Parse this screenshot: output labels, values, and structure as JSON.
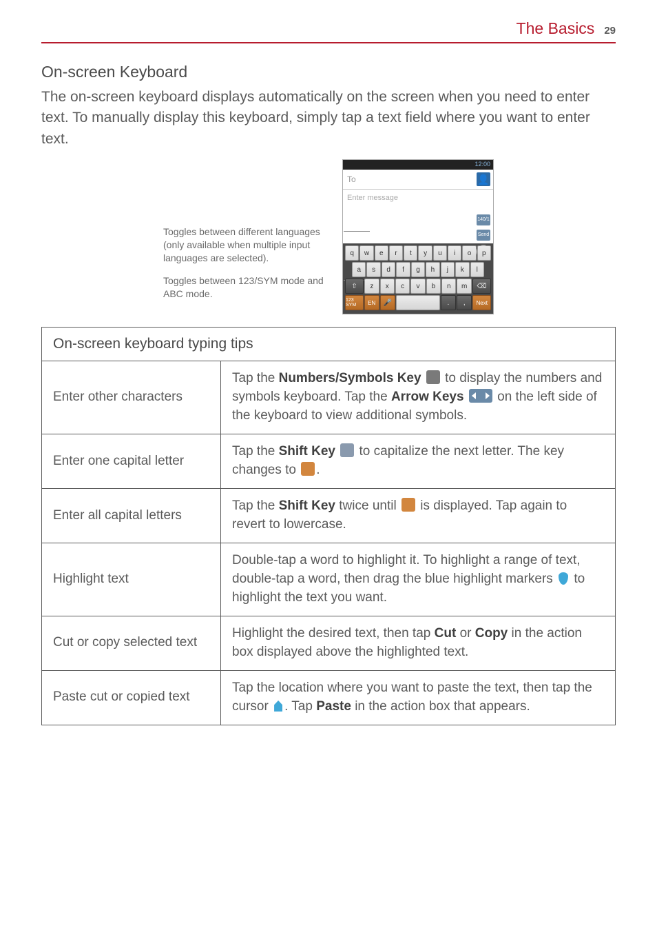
{
  "header": {
    "title": "The Basics",
    "page": "29"
  },
  "section": {
    "title": "On-screen Keyboard",
    "intro": "The on-screen keyboard displays automatically on the screen when you need to enter text. To manually display this keyboard, simply tap a text field where you want to enter text."
  },
  "callouts": {
    "lang": "Toggles between different languages (only available when multiple input languages are selected).",
    "mode": "Toggles between 123/SYM mode and ABC mode."
  },
  "phone": {
    "time": "12:00",
    "to_placeholder": "To",
    "msg_placeholder": "Enter message",
    "char_badge": "140/1",
    "send": "Send",
    "row1": [
      "q",
      "w",
      "e",
      "r",
      "t",
      "y",
      "u",
      "i",
      "o",
      "p"
    ],
    "row2": [
      "a",
      "s",
      "d",
      "f",
      "g",
      "h",
      "j",
      "k",
      "l"
    ],
    "row3_shift": "⇧",
    "row3": [
      "z",
      "x",
      "c",
      "v",
      "b",
      "n",
      "m"
    ],
    "row3_del": "⌫",
    "row4_sym": "123\nSYM",
    "row4_lang": "EN",
    "row4_mic": "🎤",
    "row4_space": " ",
    "row4_dot": ".",
    "row4_comma": ",",
    "row4_next": "Next"
  },
  "table": {
    "heading": "On-screen keyboard typing tips",
    "rows": [
      {
        "label": "Enter other characters",
        "pre1": "Tap the ",
        "b1": "Numbers/Symbols Key",
        "post1": " to display the numbers and symbols keyboard. Tap the ",
        "b2": "Arrow Keys",
        "post2": " on the left side of the keyboard to view additional symbols."
      },
      {
        "label": "Enter one capital letter",
        "pre1": "Tap the ",
        "b1": "Shift Key",
        "post1": " to capitalize the next letter. The key changes to ",
        "post2": "."
      },
      {
        "label": "Enter all capital letters",
        "pre1": "Tap the ",
        "b1": "Shift Key",
        "post1": " twice until ",
        "post2": " is displayed. Tap again to revert to lowercase."
      },
      {
        "label": "Highlight text",
        "text1": "Double-tap a word to highlight it. To highlight a range of text, double-tap a word, then drag the blue highlight markers ",
        "text2": " to highlight the text you want."
      },
      {
        "label": "Cut or copy selected text",
        "pre1": "Highlight the desired text, then tap ",
        "b1": "Cut",
        "mid": " or ",
        "b2": "Copy",
        "post": " in the action box displayed above the highlighted text."
      },
      {
        "label": "Paste cut or copied text",
        "pre1": "Tap the location where you want to paste the text, then tap the cursor ",
        "mid": ". Tap ",
        "b1": "Paste",
        "post": " in the action box that appears."
      }
    ]
  }
}
